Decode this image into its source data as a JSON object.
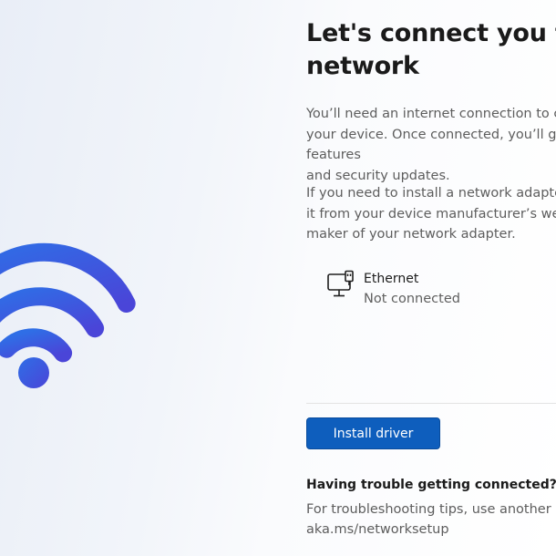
{
  "page": {
    "title": "Let's connect you to a\nnetwork",
    "intro": "You’ll need an internet connection to continue setting up\nyour device. Once connected, you’ll get the latest features\nand security updates.",
    "adapter_note": "If you need to install a network adapter driver, download\nit from your device manufacturer’s website or the\nmaker of your network adapter."
  },
  "network": {
    "icon": "ethernet-icon",
    "name": "Ethernet",
    "status": "Not connected"
  },
  "actions": {
    "install_driver": "Install driver"
  },
  "help": {
    "heading": "Having trouble getting connected?",
    "text": "For troubleshooting tips, use another device to go to\naka.ms/networksetup"
  },
  "illustration": {
    "icon": "wifi-illustration-icon",
    "color_from": "#2f66e0",
    "color_to": "#5b3fd6"
  }
}
